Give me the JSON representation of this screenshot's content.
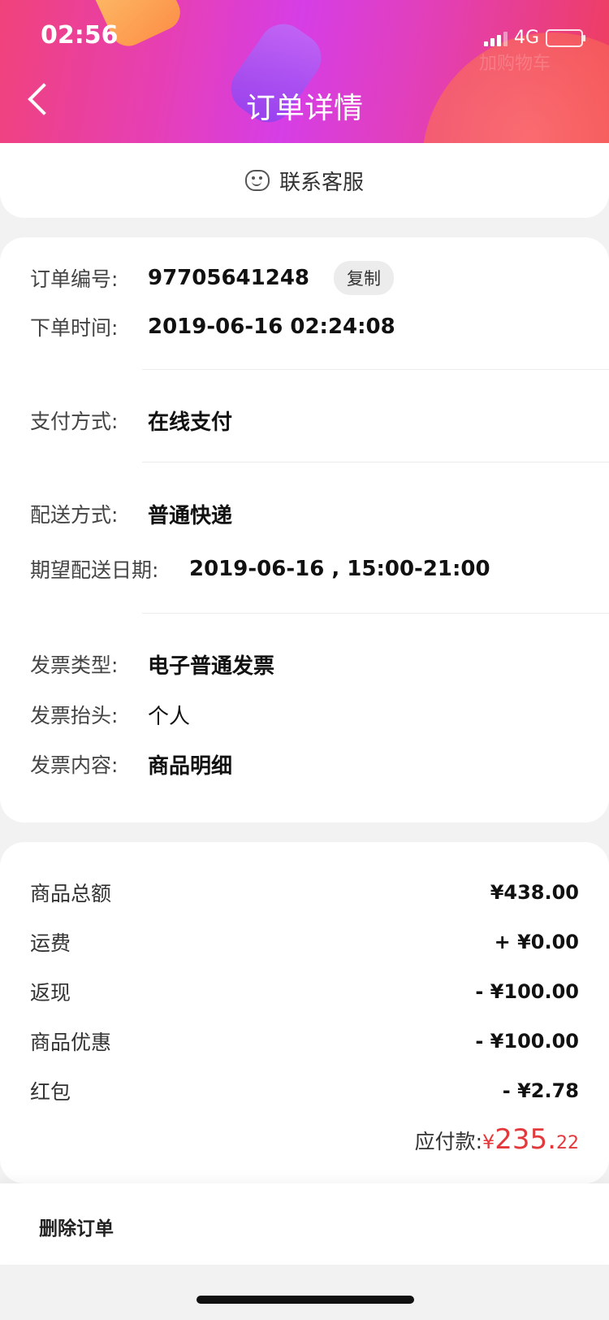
{
  "status_bar": {
    "time": "02:56",
    "network": "4G"
  },
  "header": {
    "title": "订单详情",
    "back_icon": "chevron-left-icon",
    "watermark": "加购物车"
  },
  "customer_service": {
    "label": "联系客服",
    "icon": "chat-smile-icon"
  },
  "order_info": {
    "order_number_label": "订单编号:",
    "order_number": "97705641248",
    "copy_label": "复制",
    "order_time_label": "下单时间:",
    "order_time": "2019-06-16 02:24:08",
    "payment_label": "支付方式:",
    "payment": "在线支付",
    "delivery_label": "配送方式:",
    "delivery": "普通快递",
    "expected_date_label": "期望配送日期:",
    "expected_date": "2019-06-16 , 15:00-21:00",
    "invoice_type_label": "发票类型:",
    "invoice_type": "电子普通发票",
    "invoice_title_label": "发票抬头:",
    "invoice_title": "个人",
    "invoice_content_label": "发票内容:",
    "invoice_content": "商品明细"
  },
  "price_info": {
    "items": [
      {
        "label": "商品总额",
        "value": "¥438.00"
      },
      {
        "label": "运费",
        "value": "+ ¥0.00"
      },
      {
        "label": "返现",
        "value": "- ¥100.00"
      },
      {
        "label": "商品优惠",
        "value": "- ¥100.00"
      },
      {
        "label": "红包",
        "value": "- ¥2.78"
      }
    ],
    "total_label": "应付款:",
    "total_currency": "¥",
    "total_main": "235.",
    "total_fraction": "22"
  },
  "footer": {
    "delete_label": "删除订单"
  },
  "colors": {
    "accent": "#e4393c",
    "header_left": "#f0427a",
    "header_mid": "#d63ee6",
    "header_right": "#ef3e5c"
  }
}
